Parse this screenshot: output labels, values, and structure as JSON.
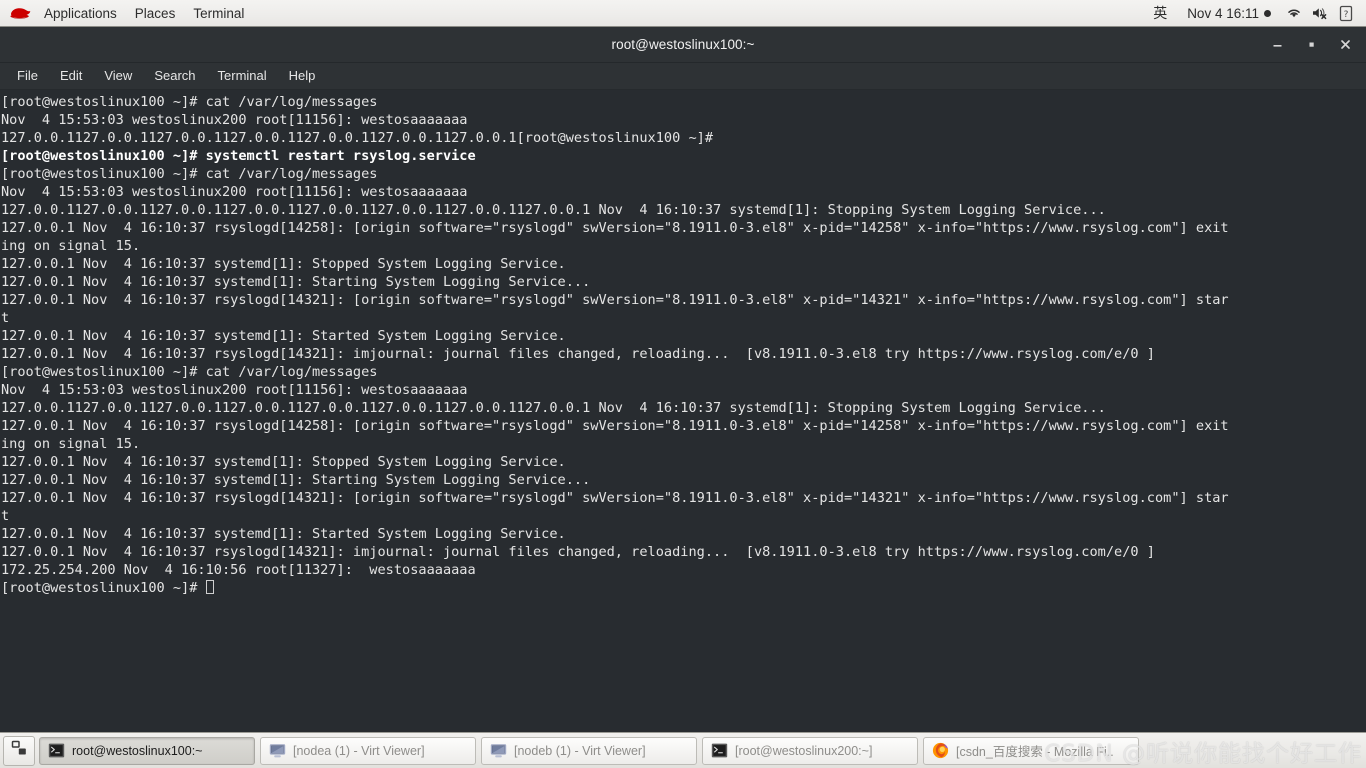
{
  "top_panel": {
    "logo_icon": "redhat-fedora-icon",
    "menus": [
      "Applications",
      "Places",
      "Terminal"
    ],
    "ime_label": "英",
    "clock": "Nov 4  16:11",
    "tray_icons": [
      "wifi-icon",
      "volume-muted-icon",
      "battery-unknown-icon"
    ]
  },
  "window": {
    "title": "root@westoslinux100:~",
    "controls": {
      "minimize": "–",
      "maximize": "■",
      "close": "✕"
    },
    "menubar": [
      "File",
      "Edit",
      "View",
      "Search",
      "Terminal",
      "Help"
    ]
  },
  "terminal": {
    "lines": [
      {
        "text": "[root@westoslinux100 ~]# cat /var/log/messages",
        "bold": false
      },
      {
        "text": "Nov  4 15:53:03 westoslinux200 root[11156]: westosaaaaaaa",
        "bold": false
      },
      {
        "text": "127.0.0.1127.0.0.1127.0.0.1127.0.0.1127.0.0.1127.0.0.1127.0.0.1[root@westoslinux100 ~]#",
        "bold": false
      },
      {
        "text": "[root@westoslinux100 ~]# systemctl restart rsyslog.service",
        "bold": true
      },
      {
        "text": "[root@westoslinux100 ~]# cat /var/log/messages",
        "bold": false
      },
      {
        "text": "Nov  4 15:53:03 westoslinux200 root[11156]: westosaaaaaaa",
        "bold": false
      },
      {
        "text": "127.0.0.1127.0.0.1127.0.0.1127.0.0.1127.0.0.1127.0.0.1127.0.0.1127.0.0.1 Nov  4 16:10:37 systemd[1]: Stopping System Logging Service...",
        "bold": false
      },
      {
        "text": "127.0.0.1 Nov  4 16:10:37 rsyslogd[14258]: [origin software=\"rsyslogd\" swVersion=\"8.1911.0-3.el8\" x-pid=\"14258\" x-info=\"https://www.rsyslog.com\"] exit",
        "bold": false
      },
      {
        "text": "ing on signal 15.",
        "bold": false
      },
      {
        "text": "127.0.0.1 Nov  4 16:10:37 systemd[1]: Stopped System Logging Service.",
        "bold": false
      },
      {
        "text": "127.0.0.1 Nov  4 16:10:37 systemd[1]: Starting System Logging Service...",
        "bold": false
      },
      {
        "text": "127.0.0.1 Nov  4 16:10:37 rsyslogd[14321]: [origin software=\"rsyslogd\" swVersion=\"8.1911.0-3.el8\" x-pid=\"14321\" x-info=\"https://www.rsyslog.com\"] star",
        "bold": false
      },
      {
        "text": "t",
        "bold": false
      },
      {
        "text": "127.0.0.1 Nov  4 16:10:37 systemd[1]: Started System Logging Service.",
        "bold": false
      },
      {
        "text": "127.0.0.1 Nov  4 16:10:37 rsyslogd[14321]: imjournal: journal files changed, reloading...  [v8.1911.0-3.el8 try https://www.rsyslog.com/e/0 ]",
        "bold": false
      },
      {
        "text": "[root@westoslinux100 ~]# cat /var/log/messages",
        "bold": false
      },
      {
        "text": "Nov  4 15:53:03 westoslinux200 root[11156]: westosaaaaaaa",
        "bold": false
      },
      {
        "text": "127.0.0.1127.0.0.1127.0.0.1127.0.0.1127.0.0.1127.0.0.1127.0.0.1127.0.0.1 Nov  4 16:10:37 systemd[1]: Stopping System Logging Service...",
        "bold": false
      },
      {
        "text": "127.0.0.1 Nov  4 16:10:37 rsyslogd[14258]: [origin software=\"rsyslogd\" swVersion=\"8.1911.0-3.el8\" x-pid=\"14258\" x-info=\"https://www.rsyslog.com\"] exit",
        "bold": false
      },
      {
        "text": "ing on signal 15.",
        "bold": false
      },
      {
        "text": "127.0.0.1 Nov  4 16:10:37 systemd[1]: Stopped System Logging Service.",
        "bold": false
      },
      {
        "text": "127.0.0.1 Nov  4 16:10:37 systemd[1]: Starting System Logging Service...",
        "bold": false
      },
      {
        "text": "127.0.0.1 Nov  4 16:10:37 rsyslogd[14321]: [origin software=\"rsyslogd\" swVersion=\"8.1911.0-3.el8\" x-pid=\"14321\" x-info=\"https://www.rsyslog.com\"] star",
        "bold": false
      },
      {
        "text": "t",
        "bold": false
      },
      {
        "text": "127.0.0.1 Nov  4 16:10:37 systemd[1]: Started System Logging Service.",
        "bold": false
      },
      {
        "text": "127.0.0.1 Nov  4 16:10:37 rsyslogd[14321]: imjournal: journal files changed, reloading...  [v8.1911.0-3.el8 try https://www.rsyslog.com/e/0 ]",
        "bold": false
      },
      {
        "text": "172.25.254.200 Nov  4 16:10:56 root[11327]:  westosaaaaaaa",
        "bold": false
      }
    ],
    "prompt": "[root@westoslinux100 ~]# ",
    "cursor": "block-cursor"
  },
  "taskbar": {
    "show_desktop_icon": "show-desktop-icon",
    "tasks": [
      {
        "label": "root@westoslinux100:~",
        "icon": "terminal-icon",
        "active": true
      },
      {
        "label": "[nodea (1) - Virt Viewer]",
        "icon": "monitor-icon",
        "active": false
      },
      {
        "label": "[nodeb (1) - Virt Viewer]",
        "icon": "monitor-icon",
        "active": false
      },
      {
        "label": "[root@westoslinux200:~]",
        "icon": "terminal-icon",
        "active": false
      },
      {
        "label": "[csdn_百度搜索 - Mozilla Fi..",
        "icon": "firefox-icon",
        "active": false
      }
    ]
  },
  "watermark": {
    "text": "CSDN @听说你能找个好工作"
  },
  "colors": {
    "panel_bg": "#eeedeb",
    "terminal_bg": "#282c30",
    "titlebar_bg": "#2e3235",
    "terminal_fg": "#e4e4e4",
    "accent_red": "#cc0000"
  }
}
